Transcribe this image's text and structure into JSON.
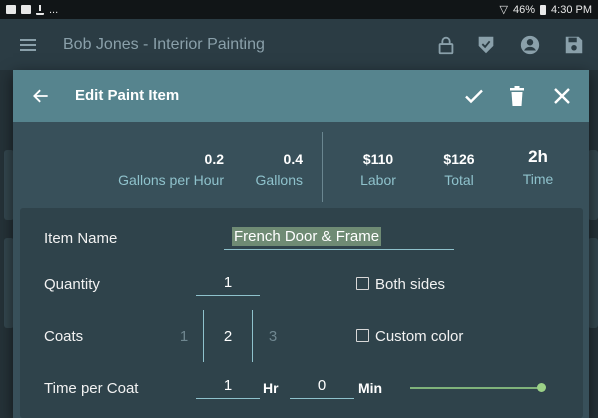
{
  "status_bar": {
    "dots": "...",
    "signal_pct": "46%",
    "time": "4:30 PM"
  },
  "app_bar": {
    "title": "Bob Jones - Interior Painting"
  },
  "dialog": {
    "title": "Edit Paint Item",
    "stats": {
      "gallons_per_hour": {
        "value": "0.2",
        "label": "Gallons per Hour"
      },
      "gallons": {
        "value": "0.4",
        "label": "Gallons"
      },
      "labor": {
        "value": "$110",
        "label": "Labor"
      },
      "total": {
        "value": "$126",
        "label": "Total"
      },
      "time": {
        "value": "2h",
        "label": "Time"
      }
    },
    "form": {
      "item_name_label": "Item Name",
      "item_name_value": "French Door & Frame",
      "quantity_label": "Quantity",
      "quantity_value": "1",
      "both_sides_label": "Both sides",
      "both_sides_checked": false,
      "coats_label": "Coats",
      "coats_options": [
        "1",
        "2",
        "3"
      ],
      "coats_selected": "2",
      "custom_color_label": "Custom color",
      "custom_color_checked": false,
      "time_per_coat_label": "Time per Coat",
      "hours_value": "1",
      "hours_unit": "Hr",
      "minutes_value": "0",
      "minutes_unit": "Min",
      "slider_level": 1.0
    }
  },
  "colors": {
    "accent": "#8fc2cc",
    "header": "#56848e",
    "slider": "#9bd187",
    "highlight": "#6f8b74"
  },
  "icons": [
    "menu-icon",
    "lock-icon",
    "shield-check-icon",
    "account-icon",
    "save-icon",
    "back-arrow-icon",
    "check-icon",
    "delete-icon",
    "close-icon"
  ]
}
